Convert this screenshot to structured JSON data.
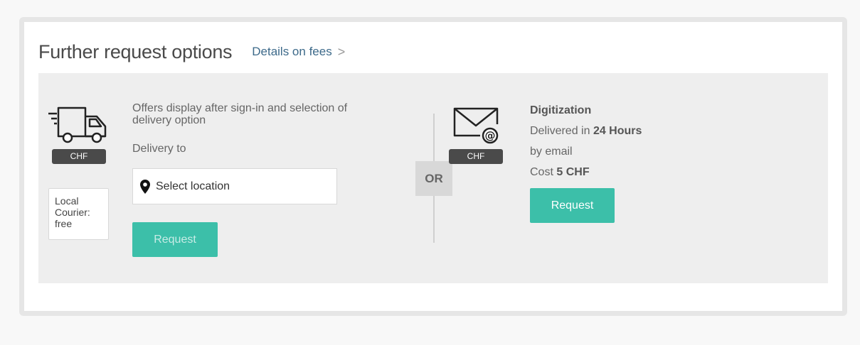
{
  "header": {
    "title": "Further request options",
    "details_link": "Details on fees",
    "chevron": ">"
  },
  "delivery": {
    "truck_icon": "truck-icon",
    "currency_badge": "CHF",
    "courier_line1": "Local",
    "courier_line2": "Courier:",
    "courier_line3": "free",
    "offers_text": "Offers display after sign-in and selection of delivery option",
    "delivery_to_label": "Delivery to",
    "location_placeholder": "Select location",
    "request_label": "Request"
  },
  "separator": {
    "or_label": "OR"
  },
  "digitization": {
    "envelope_icon": "envelope-at-icon",
    "currency_badge": "CHF",
    "title": "Digitization",
    "delivered_prefix": "Delivered in",
    "delivered_time": "24 Hours",
    "by_email": "by email",
    "cost_prefix": "Cost",
    "cost_amount": "5",
    "cost_currency": "CHF",
    "request_label": "Request"
  },
  "colors": {
    "accent": "#3cbfa9",
    "badge": "#4a4a4a",
    "link": "#3d6a8a",
    "panel_bg": "#eeeeee"
  }
}
